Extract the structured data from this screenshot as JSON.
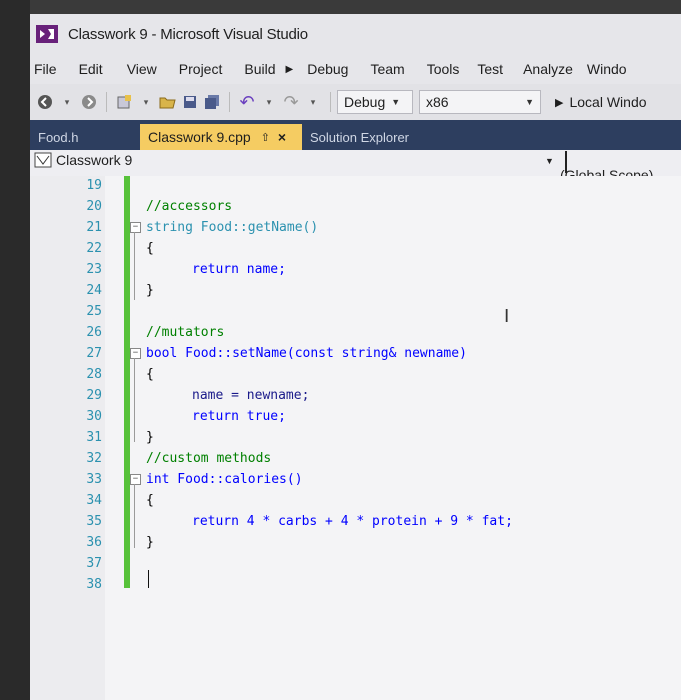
{
  "window": {
    "title": "Classwork 9 - Microsoft Visual Studio"
  },
  "menu": {
    "items": [
      "File",
      "Edit",
      "View",
      "Project",
      "Build",
      "Debug",
      "Team",
      "Tools",
      "Test",
      "Analyze",
      "Windo"
    ]
  },
  "toolbar": {
    "config": "Debug",
    "platform": "x86",
    "run_label": "Local Windo"
  },
  "tabs": {
    "inactive": "Food.h",
    "active": "Classwork 9.cpp",
    "close": "×",
    "pin": "⇧",
    "extra": "Solution Explorer"
  },
  "navbar": {
    "project": "Classwork 9",
    "scope": "(Global Scope)"
  },
  "code_lines": [
    {
      "n": "19",
      "text": ""
    },
    {
      "n": "20",
      "text": "//accessors"
    },
    {
      "n": "21",
      "text": "string Food::getName()"
    },
    {
      "n": "22",
      "text": "{"
    },
    {
      "n": "23",
      "text": "return name;"
    },
    {
      "n": "24",
      "text": "}"
    },
    {
      "n": "25",
      "text": ""
    },
    {
      "n": "26",
      "text": "//mutators"
    },
    {
      "n": "27",
      "text": "bool Food::setName(const string& newname)"
    },
    {
      "n": "28",
      "text": "{"
    },
    {
      "n": "29",
      "text": "name = newname;"
    },
    {
      "n": "30",
      "text": "return true;"
    },
    {
      "n": "31",
      "text": "}"
    },
    {
      "n": "32",
      "text": "//custom methods"
    },
    {
      "n": "33",
      "text": "int Food::calories()"
    },
    {
      "n": "34",
      "text": "{"
    },
    {
      "n": "35",
      "text": "return 4 * carbs + 4 * protein + 9 * fat;"
    },
    {
      "n": "36",
      "text": "}"
    },
    {
      "n": "37",
      "text": ""
    },
    {
      "n": "38",
      "text": ""
    }
  ],
  "colors": {
    "keyword": "#0000ff",
    "comment": "#008000",
    "type": "#2b91af",
    "active_tab": "#f5cc62",
    "change_bar": "#57c23a"
  }
}
